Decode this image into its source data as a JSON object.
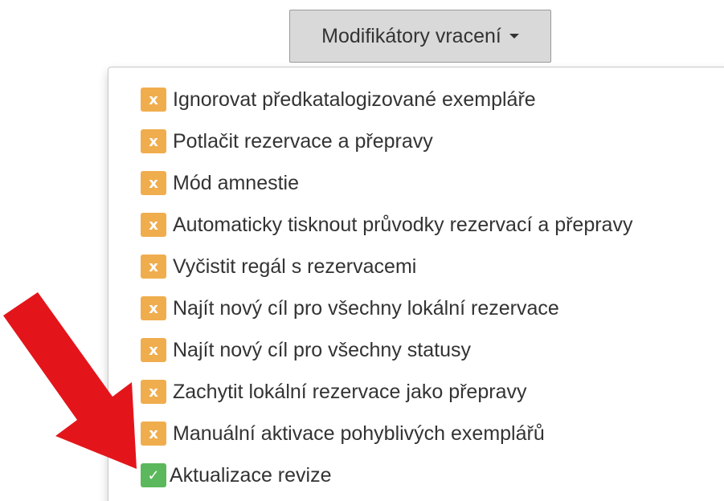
{
  "toggle": {
    "label": "Modifikátory vracení"
  },
  "colors": {
    "badge_off": "#f0ad4e",
    "badge_on": "#5cb85c",
    "arrow": "#e3151b"
  },
  "items": [
    {
      "label": "Ignorovat předkatalogizované exempláře",
      "state": "off",
      "icon": "x-icon",
      "glyph": "x"
    },
    {
      "label": "Potlačit rezervace a přepravy",
      "state": "off",
      "icon": "x-icon",
      "glyph": "x"
    },
    {
      "label": "Mód amnestie",
      "state": "off",
      "icon": "x-icon",
      "glyph": "x"
    },
    {
      "label": "Automaticky tisknout průvodky rezervací a přepravy",
      "state": "off",
      "icon": "x-icon",
      "glyph": "x"
    },
    {
      "label": "Vyčistit regál s rezervacemi",
      "state": "off",
      "icon": "x-icon",
      "glyph": "x"
    },
    {
      "label": "Najít nový cíl pro všechny lokální rezervace",
      "state": "off",
      "icon": "x-icon",
      "glyph": "x"
    },
    {
      "label": "Najít nový cíl pro všechny statusy",
      "state": "off",
      "icon": "x-icon",
      "glyph": "x"
    },
    {
      "label": "Zachytit lokální rezervace jako přepravy",
      "state": "off",
      "icon": "x-icon",
      "glyph": "x"
    },
    {
      "label": "Manuální aktivace pohyblivých exemplářů",
      "state": "off",
      "icon": "x-icon",
      "glyph": "x"
    },
    {
      "label": "Aktualizace revize",
      "state": "on",
      "icon": "check-icon",
      "glyph": "✓"
    }
  ]
}
